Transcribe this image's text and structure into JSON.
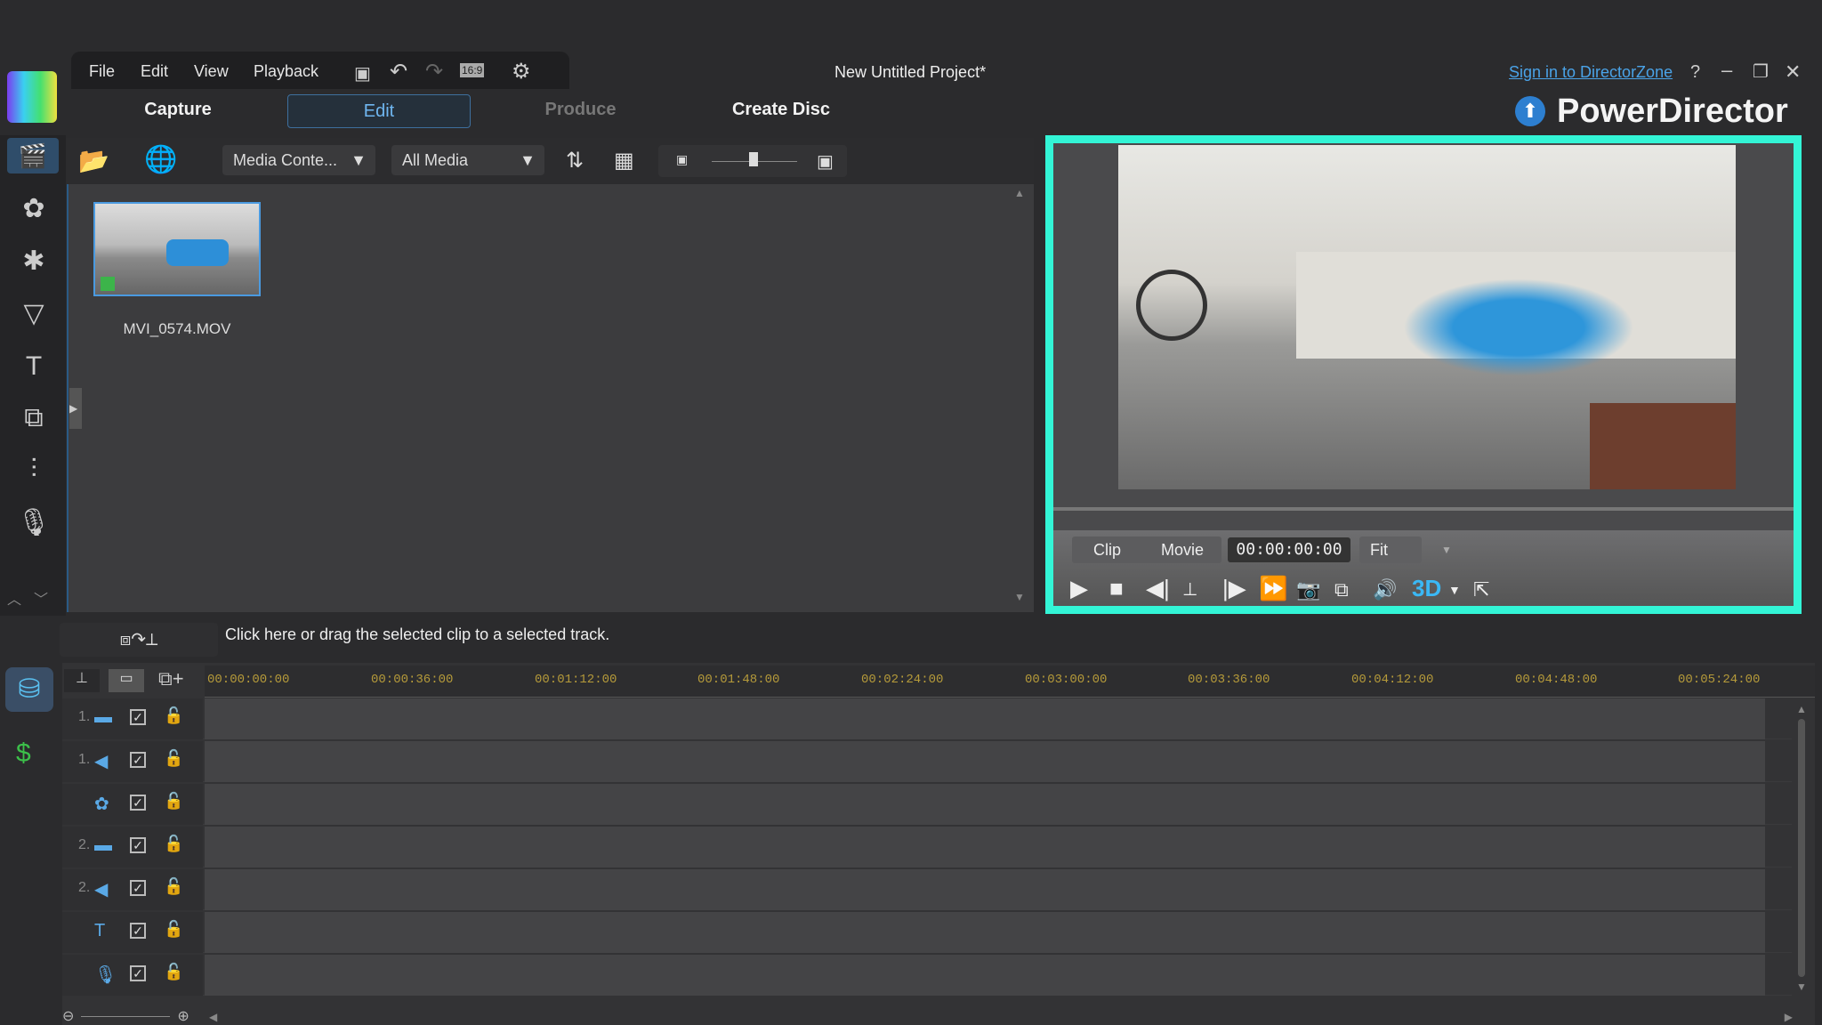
{
  "menu": {
    "items": [
      "File",
      "Edit",
      "View",
      "Playback"
    ],
    "aspect": "16:9"
  },
  "window": {
    "title": "New Untitled Project*",
    "sign_in": "Sign in to DirectorZone",
    "help": "?",
    "brand": "PowerDirector"
  },
  "tabs": {
    "capture": "Capture",
    "edit": "Edit",
    "produce": "Produce",
    "create_disc": "Create Disc"
  },
  "library": {
    "dropdown_content": "Media Conte...",
    "dropdown_filter": "All Media",
    "clip_name": "MVI_0574.MOV"
  },
  "preview": {
    "mode_clip": "Clip",
    "mode_movie": "Movie",
    "timecode": "00:00:00:00",
    "zoom": "Fit",
    "threed": "3D"
  },
  "timeline": {
    "hint": "Click here or drag the selected clip to a selected track.",
    "ruler": [
      "00:00:00:00",
      "00:00:36:00",
      "00:01:12:00",
      "00:01:48:00",
      "00:02:24:00",
      "00:03:00:00",
      "00:03:36:00",
      "00:04:12:00",
      "00:04:48:00",
      "00:05:24:00"
    ],
    "tracks": [
      {
        "num": "1.",
        "icon": "video-track-icon",
        "glyph": "▬"
      },
      {
        "num": "1.",
        "icon": "audio-track-icon",
        "glyph": "◀"
      },
      {
        "num": "",
        "icon": "effect-track-icon",
        "glyph": "✿"
      },
      {
        "num": "2.",
        "icon": "video-track-icon",
        "glyph": "▬"
      },
      {
        "num": "2.",
        "icon": "audio-track-icon",
        "glyph": "◀"
      },
      {
        "num": "",
        "icon": "title-track-icon",
        "glyph": "T"
      },
      {
        "num": "",
        "icon": "voice-track-icon",
        "glyph": "🎙"
      }
    ]
  },
  "colors": {
    "accent": "#33f5d6",
    "timecode": "#b59a3a"
  }
}
